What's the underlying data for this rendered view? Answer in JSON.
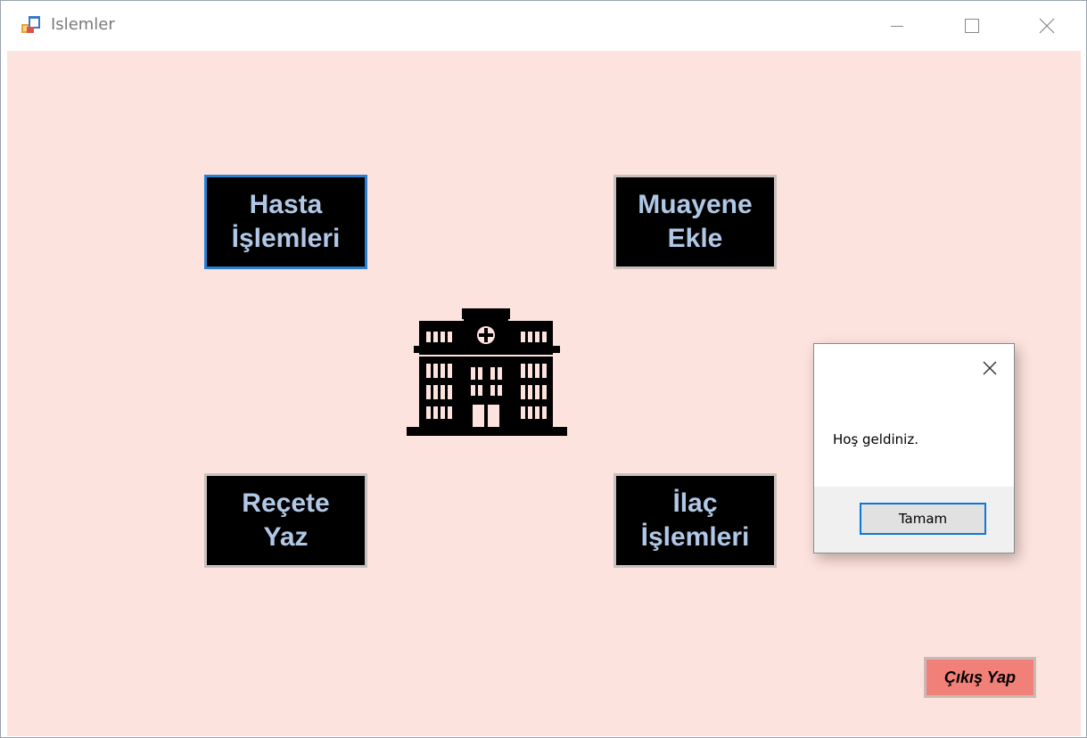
{
  "window": {
    "title": "Islemler"
  },
  "buttons": {
    "hasta": "Hasta\nİşlemleri",
    "muayene": "Muayene\nEkle",
    "recete": "Reçete\nYaz",
    "ilac": "İlaç\nİşlemleri",
    "exit": "Çıkış Yap"
  },
  "dialog": {
    "message": "Hoş geldiniz.",
    "ok_label": "Tamam"
  },
  "icons": {
    "app": "app-icon",
    "minimize": "minimize-icon",
    "maximize": "maximize-icon",
    "close": "close-icon",
    "hospital": "hospital-building-icon",
    "dialog_close": "close-icon"
  },
  "colors": {
    "client_background": "#fde3de",
    "button_background": "#000000",
    "button_text": "#b0c7e6",
    "focus_border": "#2a7fd2",
    "exit_button": "#f08078"
  }
}
